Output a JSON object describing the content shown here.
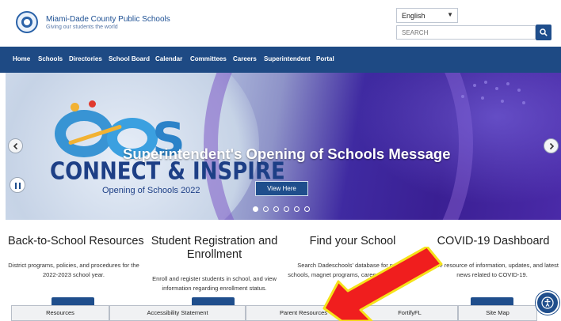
{
  "header": {
    "brand_name": "Miami-Dade County Public Schools",
    "brand_tagline": "Giving our students the world",
    "language": "English",
    "search_placeholder": "SEARCH"
  },
  "nav": {
    "items": [
      "Home",
      "Schools",
      "Directories",
      "School Board",
      "Calendar",
      "Committees",
      "Careers",
      "Superintendent",
      "Portal"
    ]
  },
  "hero": {
    "logo_word_1": "CONNECT & INSPIRE",
    "logo_word_2": "Opening of Schools 2022",
    "headline": "Superintendent's Opening of Schools Message",
    "button_label": "View Here",
    "slide_count": 6,
    "active_slide": 1
  },
  "cards": [
    {
      "title": "Back-to-School Resources",
      "text": "District programs, policies, and procedures for the 2022-2023 school year."
    },
    {
      "title": "Student Registration and Enrollment",
      "text": "Enroll and register students in school, and view information regarding enrollment status."
    },
    {
      "title": "Find your School",
      "text": "Search Dadeschools' database for nearby schools, magnet programs, career aca... and m..."
    },
    {
      "title": "COVID-19 Dashboard",
      "text": "Online resource of information, updates, and latest news related to COVID-19."
    }
  ],
  "bottom_bar": {
    "tabs": [
      "Resources",
      "Accessibility Statement",
      "Parent Resources",
      "FortifyFL",
      "Site Map"
    ]
  },
  "colors": {
    "primary": "#1e4a84",
    "annotation_arrow": "#f01e1e",
    "annotation_outline": "#f5e21a"
  },
  "icons": {
    "search": "magnifier-icon",
    "prev": "chevron-left-icon",
    "next": "chevron-right-icon",
    "pause": "pause-icon",
    "accessibility": "accessibility-icon"
  }
}
